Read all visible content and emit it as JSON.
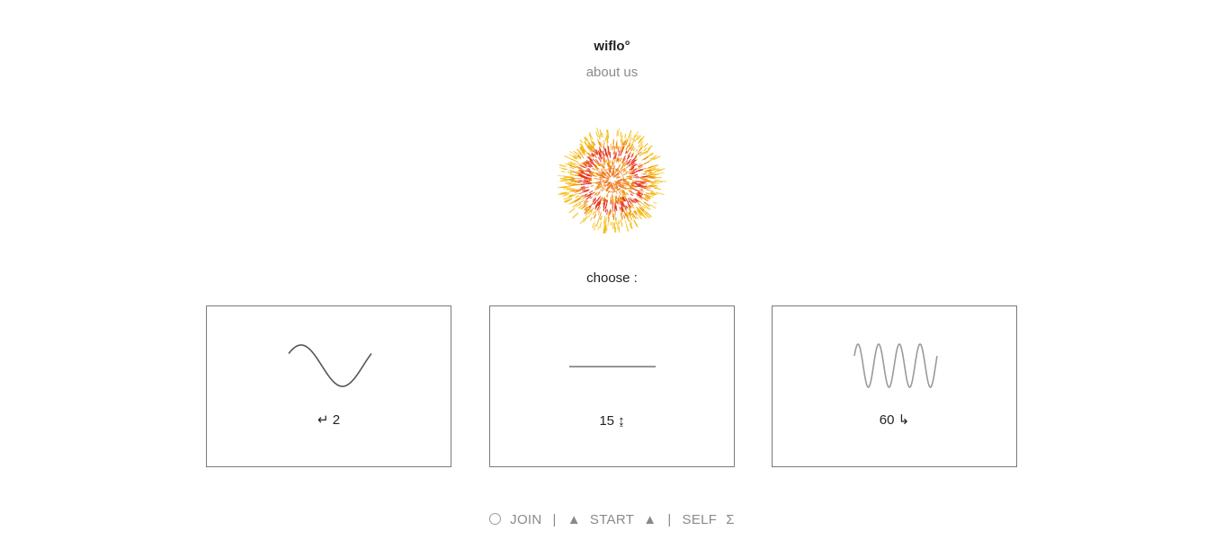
{
  "header": {
    "brand": "wiflo°",
    "about_link": "about us"
  },
  "logo": {
    "icon": "sunburst-logo-icon",
    "colors": [
      "#f5b800",
      "#f08a00",
      "#e62b14",
      "#f07a1c"
    ]
  },
  "choose_label": "choose :",
  "options": [
    {
      "label": "↵ 2",
      "icon": "sine-wave-icon",
      "stroke": "#555555"
    },
    {
      "label": "15 ↨",
      "icon": "flat-line-icon",
      "stroke": "#555555"
    },
    {
      "label": "60 ↳",
      "icon": "fast-wave-icon",
      "stroke": "#9a9a9a"
    }
  ],
  "footer": {
    "join": "JOIN",
    "separator": "|",
    "triangle": "▲",
    "start": "START",
    "self": "SELF",
    "sigma": "Σ"
  }
}
